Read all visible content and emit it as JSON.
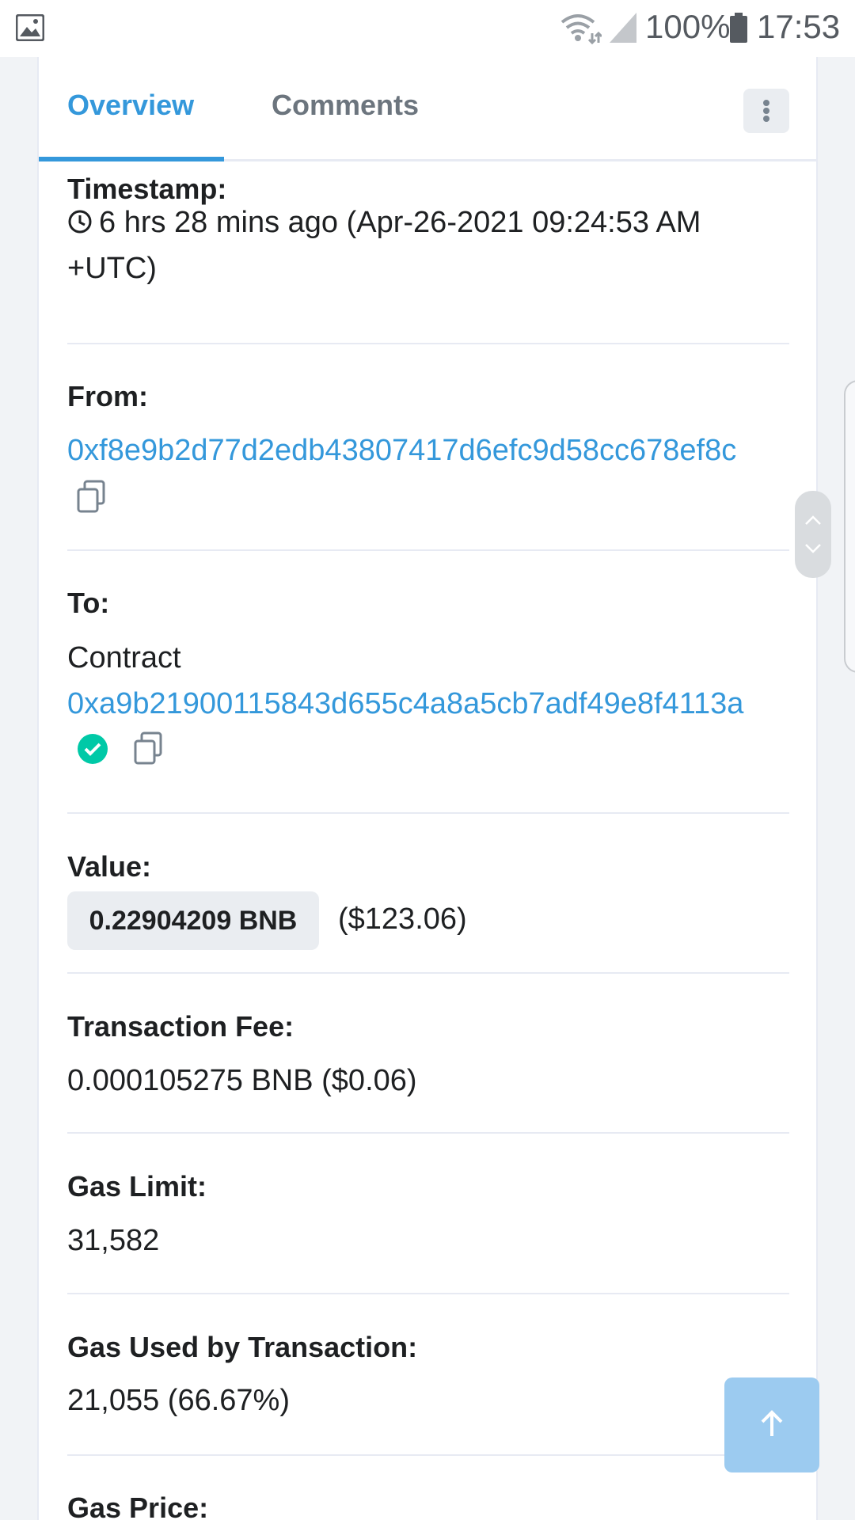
{
  "status_bar": {
    "battery_percent": "100%",
    "time": "17:53",
    "icons": [
      "gallery-icon",
      "wifi-icon",
      "signal-icon",
      "battery-icon"
    ]
  },
  "tabs": {
    "overview": "Overview",
    "comments": "Comments",
    "active": "Overview"
  },
  "fields": {
    "timestamp": {
      "label": "Timestamp:",
      "line1": "6 hrs 28 mins ago (Apr-26-2021 09:24:53 AM",
      "line2": "+UTC)"
    },
    "from": {
      "label": "From:",
      "address": "0xf8e9b2d77d2edb43807417d6efc9d58cc678ef8c"
    },
    "to": {
      "label": "To:",
      "prefix": "Contract",
      "address": "0xa9b21900115843d655c4a8a5cb7adf49e8f4113a"
    },
    "value": {
      "label": "Value:",
      "amount": "0.22904209 BNB",
      "usd": "($123.06)"
    },
    "transaction_fee": {
      "label": "Transaction Fee:",
      "value": "0.000105275 BNB ($0.06)"
    },
    "gas_limit": {
      "label": "Gas Limit:",
      "value": "31,582"
    },
    "gas_used": {
      "label": "Gas Used by Transaction:",
      "value": "21,055 (66.67%)"
    },
    "gas_price": {
      "label": "Gas Price:"
    }
  },
  "colors": {
    "accent": "#3498db",
    "verified": "#00c9a7",
    "back_to_top": "#9ccbf0"
  }
}
